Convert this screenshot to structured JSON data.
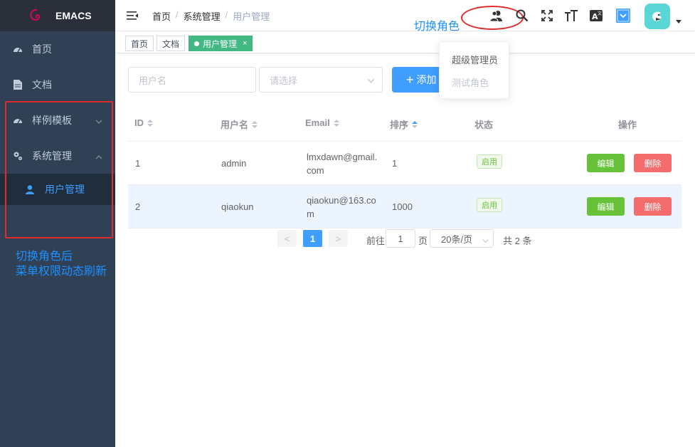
{
  "sidebar": {
    "brand": "EMACS",
    "items": [
      {
        "label": "首页"
      },
      {
        "label": "文档"
      },
      {
        "label": "样例模板"
      },
      {
        "label": "系统管理"
      }
    ],
    "sub_item": "用户管理",
    "annotation_line1": "切换角色后",
    "annotation_line2": "菜单权限动态刷新"
  },
  "navbar": {
    "breadcrumb": [
      "首页",
      "系统管理",
      "用户管理"
    ],
    "annotation": "切换角色"
  },
  "tags": [
    "首页",
    "文档",
    "用户管理"
  ],
  "tag_close": "×",
  "filter": {
    "username_placeholder": "用户名",
    "select_placeholder": "请选择",
    "add_label": "添加"
  },
  "role_menu": [
    "超级管理员",
    "测试角色"
  ],
  "table": {
    "headers": [
      "ID",
      "用户名",
      "Email",
      "排序",
      "状态",
      "操作"
    ],
    "rows": [
      {
        "id": "1",
        "username": "admin",
        "email_line1": "lmxdawn@gmail.",
        "email_line2": "com",
        "sort": "1",
        "status": "启用"
      },
      {
        "id": "2",
        "username": "qiaokun",
        "email_line1": "qiaokun@163.co",
        "email_line2": "m",
        "sort": "1000",
        "status": "启用"
      }
    ],
    "edit_label": "编辑",
    "delete_label": "删除"
  },
  "pagination": {
    "prev": "<",
    "next": ">",
    "current_page": "1",
    "goto_label": "前往",
    "goto_value": "1",
    "page_unit": "页",
    "page_size": "20条/页",
    "total": "共 2 条"
  },
  "colors": {
    "sidebar_bg": "#304156",
    "primary": "#409eff",
    "success": "#67c23a",
    "danger": "#f56c6c",
    "tag_active": "#42b983",
    "annotation": "#1e90ff",
    "highlight": "#e02b2b"
  }
}
